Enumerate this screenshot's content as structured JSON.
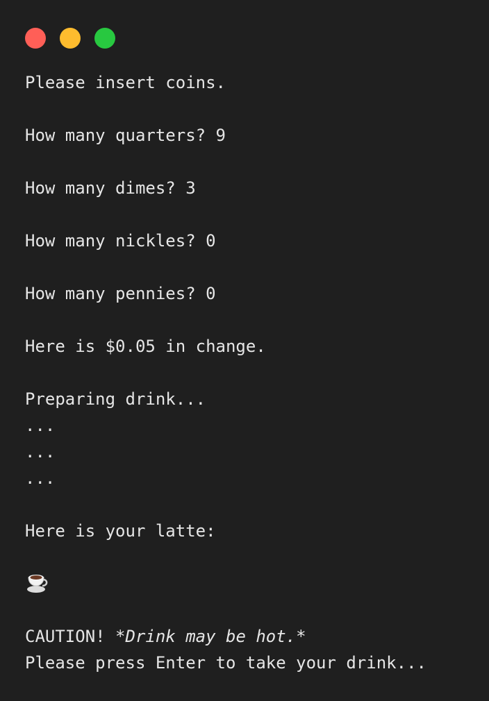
{
  "window": {
    "controls": [
      {
        "name": "close",
        "color": "#ff5f57"
      },
      {
        "name": "minimize",
        "color": "#febc2e"
      },
      {
        "name": "zoom",
        "color": "#28c840"
      }
    ]
  },
  "terminal": {
    "lines": {
      "insert": "Please insert coins.",
      "quarters": "How many quarters? 9",
      "dimes": "How many dimes? 3",
      "nickles": "How many nickles? 0",
      "pennies": "How many pennies? 0",
      "change": "Here is $0.05 in change.",
      "preparing": "Preparing drink...",
      "dots1": "...",
      "dots2": "...",
      "dots3": "...",
      "latte": "Here is your latte:",
      "caution_prefix": "CAUTION! ",
      "caution_emphasis": "*Drink may be hot.*",
      "prompt": "Please press Enter to take your drink..."
    },
    "icon": "coffee-cup-icon",
    "text_color": "#e6e6e6",
    "background": "#1f1f1f"
  }
}
